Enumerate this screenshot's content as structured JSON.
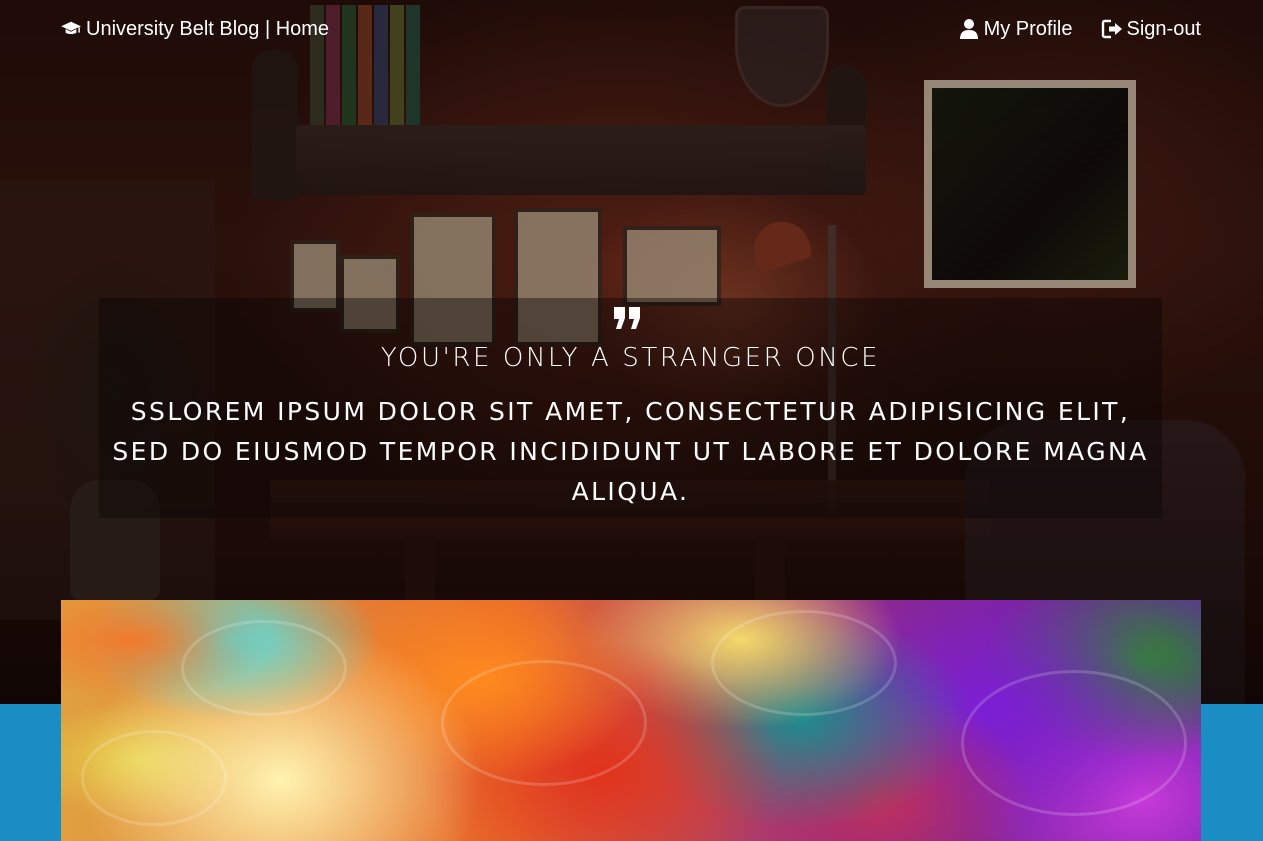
{
  "navbar": {
    "brand_label": "University Belt Blog | Home",
    "brand_icon": "graduation-cap-icon",
    "links": [
      {
        "label": "My Profile",
        "icon": "user-icon"
      },
      {
        "label": "Sign-out",
        "icon": "sign-out-icon"
      }
    ]
  },
  "hero": {
    "quote_icon": "quote-icon",
    "title": "YOU'RE ONLY A STRANGER ONCE",
    "text": "SSLOREM IPSUM DOLOR SIT AMET, CONSECTETUR ADIPISICING ELIT, SED DO EIUSMOD TEMPOR INCIDIDUNT UT LABORE ET DOLORE MAGNA ALIQUA."
  },
  "colors": {
    "band_blue": "#1a8ec4",
    "text_white": "#ffffff"
  }
}
